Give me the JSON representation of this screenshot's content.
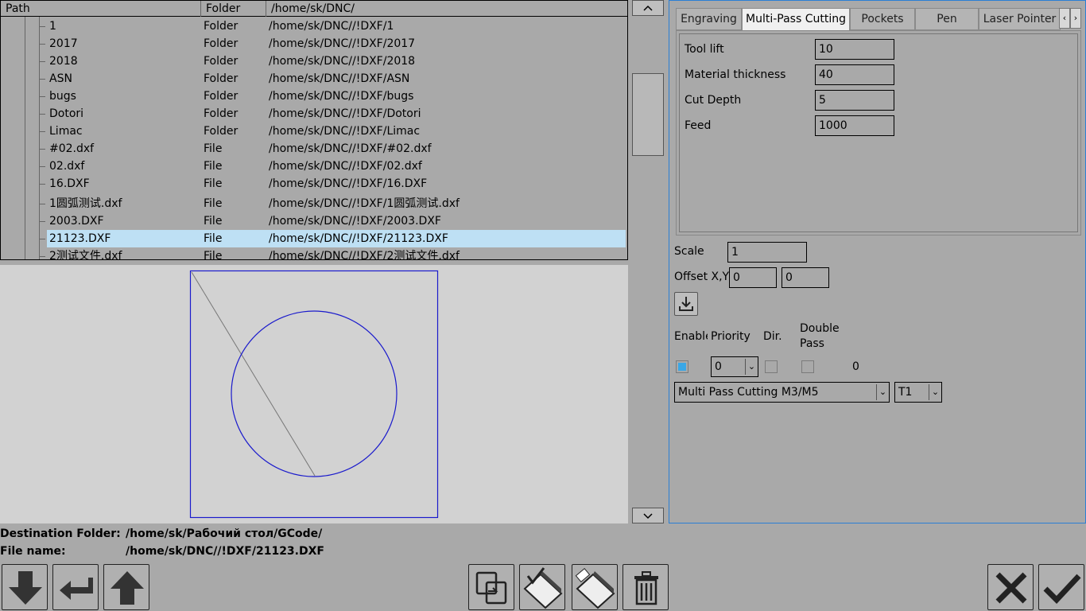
{
  "tree": {
    "headers": {
      "path": "Path",
      "type": "Folder",
      "root": "/home/sk/DNC/"
    },
    "rows": [
      {
        "name": "1",
        "type": "Folder",
        "path": "/home/sk/DNC//!DXF/1"
      },
      {
        "name": "2017",
        "type": "Folder",
        "path": "/home/sk/DNC//!DXF/2017"
      },
      {
        "name": "2018",
        "type": "Folder",
        "path": "/home/sk/DNC//!DXF/2018"
      },
      {
        "name": "ASN",
        "type": "Folder",
        "path": "/home/sk/DNC//!DXF/ASN"
      },
      {
        "name": "bugs",
        "type": "Folder",
        "path": "/home/sk/DNC//!DXF/bugs"
      },
      {
        "name": "Dotori",
        "type": "Folder",
        "path": "/home/sk/DNC//!DXF/Dotori"
      },
      {
        "name": "Limac",
        "type": "Folder",
        "path": "/home/sk/DNC//!DXF/Limac"
      },
      {
        "name": "#02.dxf",
        "type": "File",
        "path": "/home/sk/DNC//!DXF/#02.dxf"
      },
      {
        "name": "02.dxf",
        "type": "File",
        "path": "/home/sk/DNC//!DXF/02.dxf"
      },
      {
        "name": "16.DXF",
        "type": "File",
        "path": "/home/sk/DNC//!DXF/16.DXF"
      },
      {
        "name": "1圆弧测试.dxf",
        "type": "File",
        "path": "/home/sk/DNC//!DXF/1圆弧测试.dxf"
      },
      {
        "name": "2003.DXF",
        "type": "File",
        "path": "/home/sk/DNC//!DXF/2003.DXF"
      },
      {
        "name": "21123.DXF",
        "type": "File",
        "path": "/home/sk/DNC//!DXF/21123.DXF",
        "selected": true
      },
      {
        "name": "2测试文件.dxf",
        "type": "File",
        "path": "/home/sk/DNC//!DXF/2测试文件.dxf"
      }
    ]
  },
  "scrollbar": {
    "up_icon": "chevron-up-icon",
    "down_icon": "chevron-down-icon"
  },
  "tabs": [
    {
      "label": "Engraving"
    },
    {
      "label": "Multi-Pass Cutting",
      "active": true
    },
    {
      "label": "Pockets"
    },
    {
      "label": "Pen"
    },
    {
      "label": "Laser Pointer"
    }
  ],
  "params": {
    "tool_lift_label": "Tool lift",
    "tool_lift": "10",
    "material_thickness_label": "Material thickness",
    "material_thickness": "40",
    "cut_depth_label": "Cut Depth",
    "cut_depth": "5",
    "feed_label": "Feed",
    "feed": "1000"
  },
  "transform": {
    "scale_label": "Scale",
    "scale": "1",
    "offset_label": "Offset X,Y",
    "offset_x": "0",
    "offset_y": "0"
  },
  "layer_table": {
    "enable_label": "Enable",
    "priority_label": "Priority",
    "dir_label": "Dir.",
    "double_pass_label_1": "Double",
    "double_pass_label_2": "Pass",
    "enabled": true,
    "priority": "0",
    "dir": false,
    "double_pass": false,
    "count": "0"
  },
  "mode_select": "Multi Pass Cutting M3/M5",
  "tool_select": "T1",
  "bottom": {
    "dest_label": "Destination Folder:",
    "dest_value": "/home/sk/Рабочий стол/GCode/",
    "file_label": "File name:",
    "file_value": "/home/sk/DNC//!DXF/21123.DXF"
  },
  "colors": {
    "selection": "#bee0f4",
    "shape": "#1a1acc",
    "accent": "#3aa7e6"
  }
}
